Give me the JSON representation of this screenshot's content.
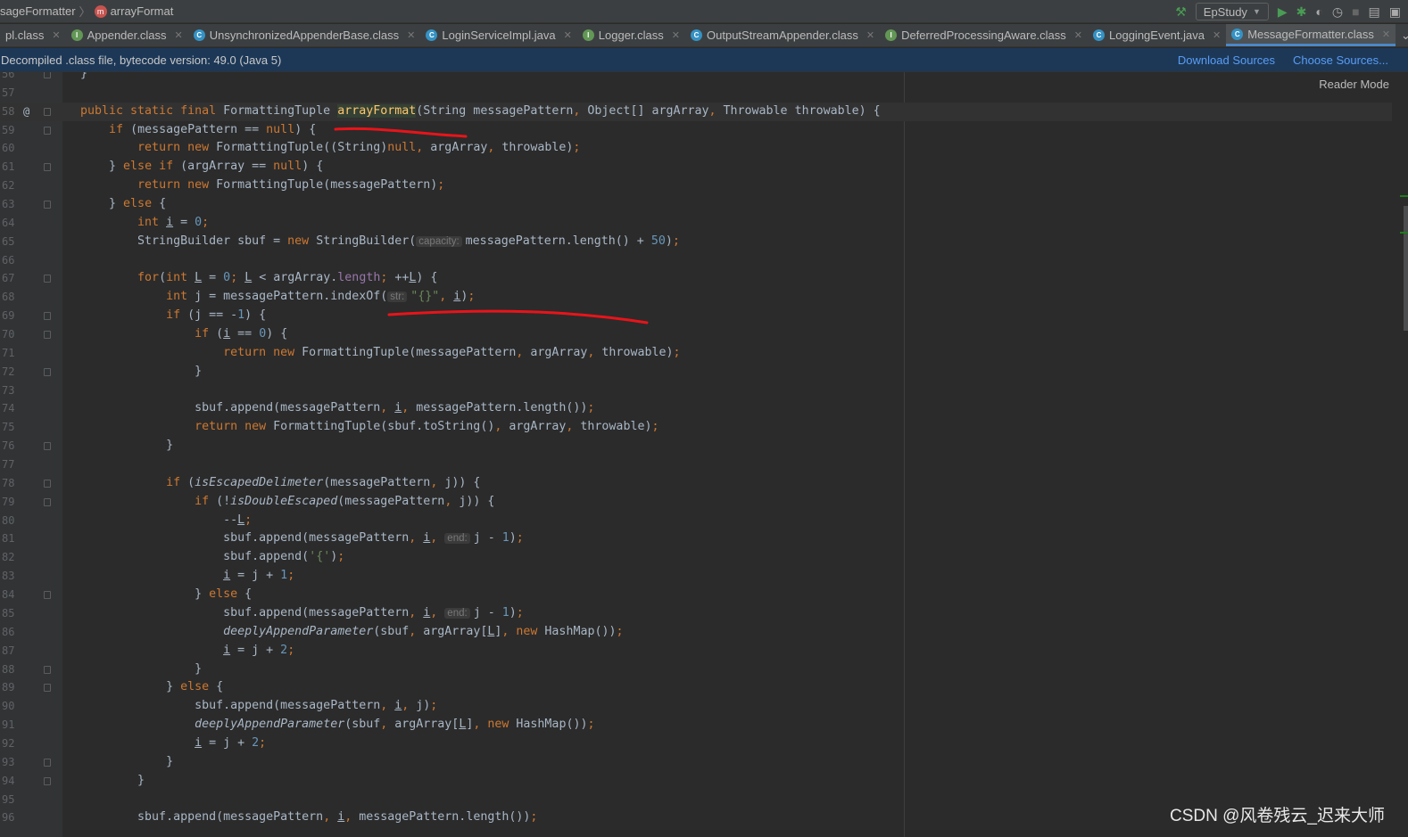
{
  "breadcrumb": {
    "class_name": "sageFormatter",
    "method_icon": "m",
    "method_name": "arrayFormat"
  },
  "toolbar": {
    "run_config": "EpStudy"
  },
  "tabs": [
    {
      "label": "pl.class",
      "icon": "",
      "active": false
    },
    {
      "label": "Appender.class",
      "icon": "I",
      "active": false
    },
    {
      "label": "UnsynchronizedAppenderBase.class",
      "icon": "C",
      "active": false
    },
    {
      "label": "LoginServiceImpl.java",
      "icon": "C",
      "active": false
    },
    {
      "label": "Logger.class",
      "icon": "I",
      "active": false
    },
    {
      "label": "OutputStreamAppender.class",
      "icon": "C",
      "active": false
    },
    {
      "label": "DeferredProcessingAware.class",
      "icon": "I",
      "active": false
    },
    {
      "label": "LoggingEvent.java",
      "icon": "C",
      "active": false
    },
    {
      "label": "MessageFormatter.class",
      "icon": "C",
      "active": true
    }
  ],
  "banner": {
    "text": "Decompiled .class file, bytecode version: 49.0 (Java 5)",
    "download": "Download Sources",
    "choose": "Choose Sources..."
  },
  "editor": {
    "reader_mode": "Reader Mode",
    "lines": [
      {
        "n": "56",
        "fold": true,
        "tokens": [
          [
            "t",
            "}"
          ]
        ]
      },
      {
        "n": "57",
        "tokens": []
      },
      {
        "n": "58",
        "fold": true,
        "marker": "@",
        "current": true,
        "tokens": [
          [
            "k",
            "public static final "
          ],
          [
            "t",
            "FormattingTuple "
          ],
          [
            "m",
            "arrayFormat"
          ],
          [
            "t",
            "(String messagePattern"
          ],
          [
            "k",
            ", "
          ],
          [
            "t",
            "Object[] argArray"
          ],
          [
            "k",
            ", "
          ],
          [
            "t",
            "Throwable throwable) {"
          ]
        ]
      },
      {
        "n": "59",
        "fold": true,
        "tokens": [
          [
            "t",
            "    "
          ],
          [
            "k",
            "if "
          ],
          [
            "t",
            "(messagePattern == "
          ],
          [
            "k",
            "null"
          ],
          [
            "t",
            ") {"
          ]
        ]
      },
      {
        "n": "60",
        "tokens": [
          [
            "t",
            "        "
          ],
          [
            "k",
            "return new "
          ],
          [
            "t",
            "FormattingTuple((String)"
          ],
          [
            "k",
            "null, "
          ],
          [
            "t",
            "argArray"
          ],
          [
            "k",
            ", "
          ],
          [
            "t",
            "throwable)"
          ],
          [
            "k",
            ";"
          ]
        ]
      },
      {
        "n": "61",
        "fold": true,
        "tokens": [
          [
            "t",
            "    } "
          ],
          [
            "k",
            "else if "
          ],
          [
            "t",
            "(argArray == "
          ],
          [
            "k",
            "null"
          ],
          [
            "t",
            ") {"
          ]
        ]
      },
      {
        "n": "62",
        "tokens": [
          [
            "t",
            "        "
          ],
          [
            "k",
            "return new "
          ],
          [
            "t",
            "FormattingTuple(messagePattern)"
          ],
          [
            "k",
            ";"
          ]
        ]
      },
      {
        "n": "63",
        "fold": true,
        "tokens": [
          [
            "t",
            "    } "
          ],
          [
            "k",
            "else "
          ],
          [
            "t",
            "{"
          ]
        ]
      },
      {
        "n": "64",
        "tokens": [
          [
            "t",
            "        "
          ],
          [
            "k",
            "int "
          ],
          [
            "u",
            "i"
          ],
          [
            "t",
            " = "
          ],
          [
            "n",
            "0"
          ],
          [
            "k",
            ";"
          ]
        ]
      },
      {
        "n": "65",
        "tokens": [
          [
            "t",
            "        StringBuilder sbuf = "
          ],
          [
            "k",
            "new "
          ],
          [
            "t",
            "StringBuilder("
          ],
          [
            "h",
            "capacity:"
          ],
          [
            "t",
            "messagePattern.length() + "
          ],
          [
            "n",
            "50"
          ],
          [
            "t",
            ")"
          ],
          [
            "k",
            ";"
          ]
        ]
      },
      {
        "n": "66",
        "tokens": []
      },
      {
        "n": "67",
        "fold": true,
        "tokens": [
          [
            "t",
            "        "
          ],
          [
            "k",
            "for"
          ],
          [
            "t",
            "("
          ],
          [
            "k",
            "int "
          ],
          [
            "u",
            "L"
          ],
          [
            "t",
            " = "
          ],
          [
            "n",
            "0"
          ],
          [
            "k",
            "; "
          ],
          [
            "u",
            "L"
          ],
          [
            "t",
            " < argArray."
          ],
          [
            "f",
            "length"
          ],
          [
            "k",
            "; "
          ],
          [
            "t",
            "++"
          ],
          [
            "u",
            "L"
          ],
          [
            "t",
            ") {"
          ]
        ]
      },
      {
        "n": "68",
        "tokens": [
          [
            "t",
            "            "
          ],
          [
            "k",
            "int "
          ],
          [
            "t",
            "j = messagePattern.indexOf("
          ],
          [
            "h",
            "str:"
          ],
          [
            "s",
            "\"{}\""
          ],
          [
            "k",
            ", "
          ],
          [
            "u",
            "i"
          ],
          [
            "t",
            ")"
          ],
          [
            "k",
            ";"
          ]
        ]
      },
      {
        "n": "69",
        "fold": true,
        "tokens": [
          [
            "t",
            "            "
          ],
          [
            "k",
            "if "
          ],
          [
            "t",
            "(j == -"
          ],
          [
            "n",
            "1"
          ],
          [
            "t",
            ") {"
          ]
        ]
      },
      {
        "n": "70",
        "fold": true,
        "tokens": [
          [
            "t",
            "                "
          ],
          [
            "k",
            "if "
          ],
          [
            "t",
            "("
          ],
          [
            "u",
            "i"
          ],
          [
            "t",
            " == "
          ],
          [
            "n",
            "0"
          ],
          [
            "t",
            ") {"
          ]
        ]
      },
      {
        "n": "71",
        "tokens": [
          [
            "t",
            "                    "
          ],
          [
            "k",
            "return new "
          ],
          [
            "t",
            "FormattingTuple(messagePattern"
          ],
          [
            "k",
            ", "
          ],
          [
            "t",
            "argArray"
          ],
          [
            "k",
            ", "
          ],
          [
            "t",
            "throwable)"
          ],
          [
            "k",
            ";"
          ]
        ]
      },
      {
        "n": "72",
        "fold": true,
        "tokens": [
          [
            "t",
            "                }"
          ]
        ]
      },
      {
        "n": "73",
        "tokens": []
      },
      {
        "n": "74",
        "tokens": [
          [
            "t",
            "                sbuf.append(messagePattern"
          ],
          [
            "k",
            ", "
          ],
          [
            "u",
            "i"
          ],
          [
            "k",
            ", "
          ],
          [
            "t",
            "messagePattern.length())"
          ],
          [
            "k",
            ";"
          ]
        ]
      },
      {
        "n": "75",
        "tokens": [
          [
            "t",
            "                "
          ],
          [
            "k",
            "return new "
          ],
          [
            "t",
            "FormattingTuple(sbuf.toString()"
          ],
          [
            "k",
            ", "
          ],
          [
            "t",
            "argArray"
          ],
          [
            "k",
            ", "
          ],
          [
            "t",
            "throwable)"
          ],
          [
            "k",
            ";"
          ]
        ]
      },
      {
        "n": "76",
        "fold": true,
        "tokens": [
          [
            "t",
            "            }"
          ]
        ]
      },
      {
        "n": "77",
        "tokens": []
      },
      {
        "n": "78",
        "fold": true,
        "tokens": [
          [
            "t",
            "            "
          ],
          [
            "k",
            "if "
          ],
          [
            "t",
            "("
          ],
          [
            "i",
            "isEscapedDelimeter"
          ],
          [
            "t",
            "(messagePattern"
          ],
          [
            "k",
            ", "
          ],
          [
            "t",
            "j)) {"
          ]
        ]
      },
      {
        "n": "79",
        "fold": true,
        "tokens": [
          [
            "t",
            "                "
          ],
          [
            "k",
            "if "
          ],
          [
            "t",
            "(!"
          ],
          [
            "i",
            "isDoubleEscaped"
          ],
          [
            "t",
            "(messagePattern"
          ],
          [
            "k",
            ", "
          ],
          [
            "t",
            "j)) {"
          ]
        ]
      },
      {
        "n": "80",
        "tokens": [
          [
            "t",
            "                    --"
          ],
          [
            "u",
            "L"
          ],
          [
            "k",
            ";"
          ]
        ]
      },
      {
        "n": "81",
        "tokens": [
          [
            "t",
            "                    sbuf.append(messagePattern"
          ],
          [
            "k",
            ", "
          ],
          [
            "u",
            "i"
          ],
          [
            "k",
            ", "
          ],
          [
            "h",
            "end:"
          ],
          [
            "t",
            "j - "
          ],
          [
            "n",
            "1"
          ],
          [
            "t",
            ")"
          ],
          [
            "k",
            ";"
          ]
        ]
      },
      {
        "n": "82",
        "tokens": [
          [
            "t",
            "                    sbuf.append("
          ],
          [
            "s",
            "'{'"
          ],
          [
            "t",
            ")"
          ],
          [
            "k",
            ";"
          ]
        ]
      },
      {
        "n": "83",
        "tokens": [
          [
            "t",
            "                    "
          ],
          [
            "u",
            "i"
          ],
          [
            "t",
            " = j + "
          ],
          [
            "n",
            "1"
          ],
          [
            "k",
            ";"
          ]
        ]
      },
      {
        "n": "84",
        "fold": true,
        "tokens": [
          [
            "t",
            "                } "
          ],
          [
            "k",
            "else "
          ],
          [
            "t",
            "{"
          ]
        ]
      },
      {
        "n": "85",
        "tokens": [
          [
            "t",
            "                    sbuf.append(messagePattern"
          ],
          [
            "k",
            ", "
          ],
          [
            "u",
            "i"
          ],
          [
            "k",
            ", "
          ],
          [
            "h",
            "end:"
          ],
          [
            "t",
            "j - "
          ],
          [
            "n",
            "1"
          ],
          [
            "t",
            ")"
          ],
          [
            "k",
            ";"
          ]
        ]
      },
      {
        "n": "86",
        "tokens": [
          [
            "t",
            "                    "
          ],
          [
            "i",
            "deeplyAppendParameter"
          ],
          [
            "t",
            "(sbuf"
          ],
          [
            "k",
            ", "
          ],
          [
            "t",
            "argArray["
          ],
          [
            "u",
            "L"
          ],
          [
            "t",
            "]"
          ],
          [
            "k",
            ", new "
          ],
          [
            "t",
            "HashMap())"
          ],
          [
            "k",
            ";"
          ]
        ]
      },
      {
        "n": "87",
        "tokens": [
          [
            "t",
            "                    "
          ],
          [
            "u",
            "i"
          ],
          [
            "t",
            " = j + "
          ],
          [
            "n",
            "2"
          ],
          [
            "k",
            ";"
          ]
        ]
      },
      {
        "n": "88",
        "fold": true,
        "tokens": [
          [
            "t",
            "                }"
          ]
        ]
      },
      {
        "n": "89",
        "fold": true,
        "tokens": [
          [
            "t",
            "            } "
          ],
          [
            "k",
            "else "
          ],
          [
            "t",
            "{"
          ]
        ]
      },
      {
        "n": "90",
        "tokens": [
          [
            "t",
            "                sbuf.append(messagePattern"
          ],
          [
            "k",
            ", "
          ],
          [
            "u",
            "i"
          ],
          [
            "k",
            ", "
          ],
          [
            "t",
            "j)"
          ],
          [
            "k",
            ";"
          ]
        ]
      },
      {
        "n": "91",
        "tokens": [
          [
            "t",
            "                "
          ],
          [
            "i",
            "deeplyAppendParameter"
          ],
          [
            "t",
            "(sbuf"
          ],
          [
            "k",
            ", "
          ],
          [
            "t",
            "argArray["
          ],
          [
            "u",
            "L"
          ],
          [
            "t",
            "]"
          ],
          [
            "k",
            ", new "
          ],
          [
            "t",
            "HashMap())"
          ],
          [
            "k",
            ";"
          ]
        ]
      },
      {
        "n": "92",
        "tokens": [
          [
            "t",
            "                "
          ],
          [
            "u",
            "i"
          ],
          [
            "t",
            " = j + "
          ],
          [
            "n",
            "2"
          ],
          [
            "k",
            ";"
          ]
        ]
      },
      {
        "n": "93",
        "fold": true,
        "tokens": [
          [
            "t",
            "            }"
          ]
        ]
      },
      {
        "n": "94",
        "fold": true,
        "tokens": [
          [
            "t",
            "        }"
          ]
        ]
      },
      {
        "n": "95",
        "tokens": []
      },
      {
        "n": "96",
        "tokens": [
          [
            "t",
            "        sbuf.append(messagePattern"
          ],
          [
            "k",
            ", "
          ],
          [
            "u",
            "i"
          ],
          [
            "k",
            ", "
          ],
          [
            "t",
            "messagePattern.length())"
          ],
          [
            "k",
            ";"
          ]
        ]
      }
    ]
  },
  "watermark": "CSDN @风卷残云_迟来大师",
  "colors": {
    "annotation": "#e8141a",
    "accent": "#4a88c7",
    "banner": "#1d3857"
  }
}
